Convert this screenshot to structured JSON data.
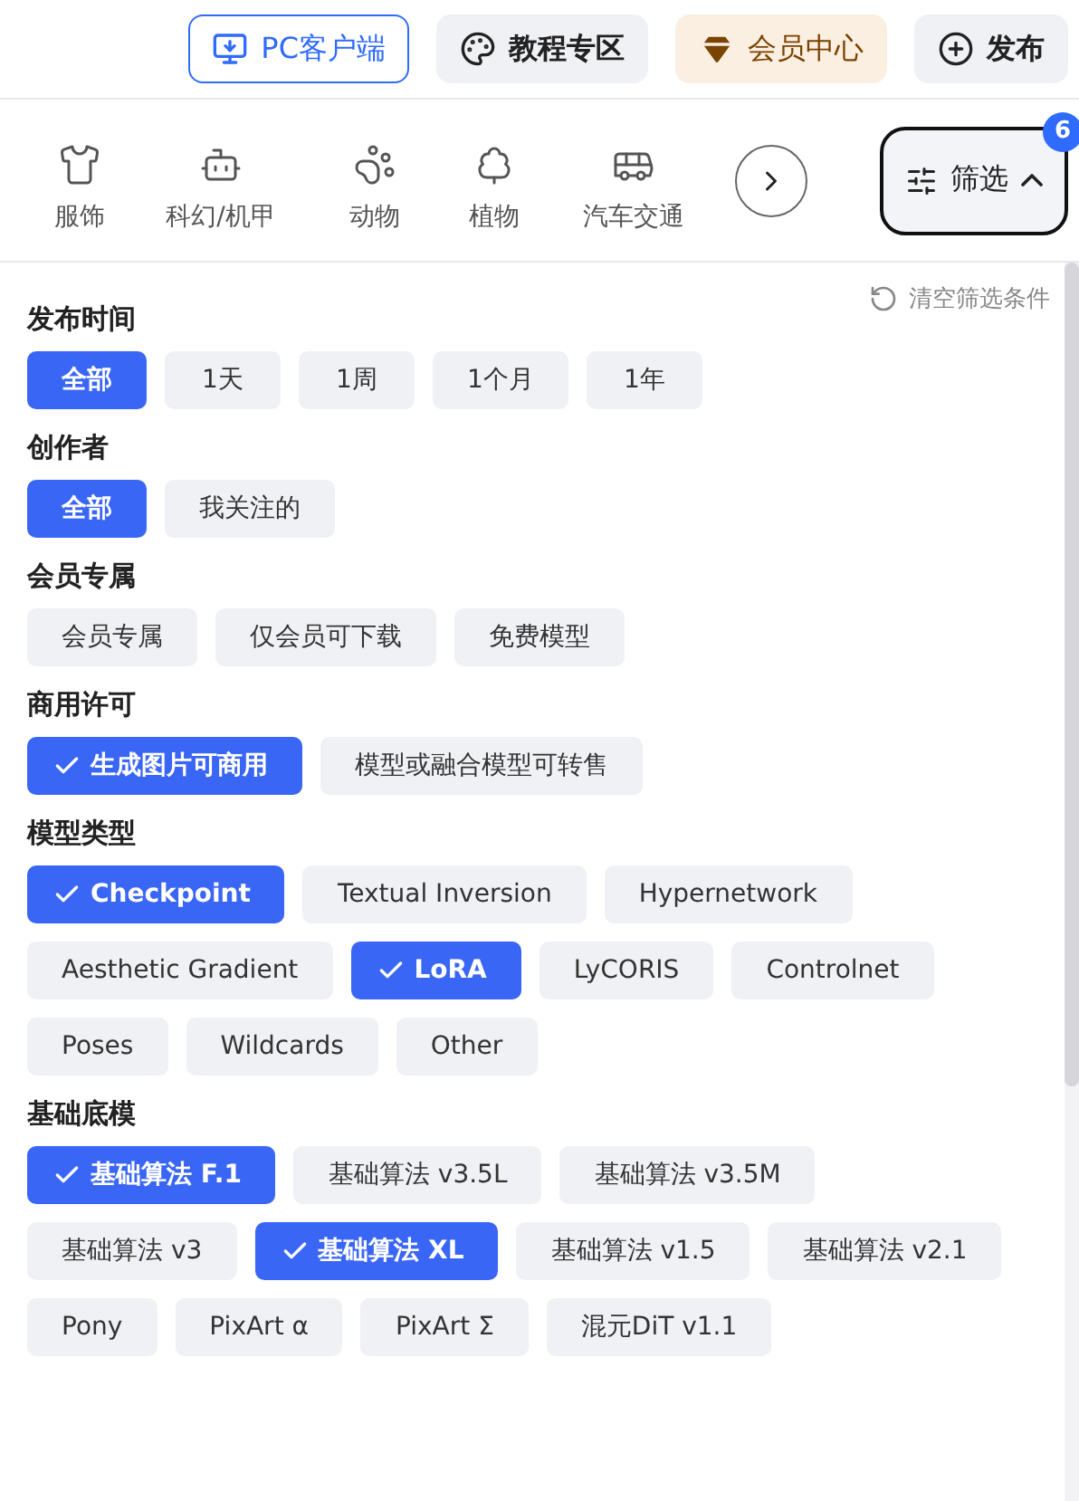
{
  "top_nav": [
    {
      "kind": "outline",
      "label": "PC客户端"
    },
    {
      "kind": "plain",
      "label": "教程专区"
    },
    {
      "kind": "vip",
      "label": "会员中心"
    },
    {
      "kind": "plain",
      "label": "发布"
    }
  ],
  "categories": [
    {
      "label": "服饰"
    },
    {
      "label": "科幻/机甲"
    },
    {
      "label": "动物"
    },
    {
      "label": "植物"
    },
    {
      "label": "汽车交通"
    }
  ],
  "filter_button": {
    "label": "筛选",
    "badge": "6",
    "expanded": true
  },
  "clear_filters": "清空筛选条件",
  "sections": [
    {
      "title": "发布时间",
      "options": [
        {
          "label": "全部",
          "selected": true
        },
        {
          "label": "1天",
          "selected": false
        },
        {
          "label": "1周",
          "selected": false
        },
        {
          "label": "1个月",
          "selected": false
        },
        {
          "label": "1年",
          "selected": false
        }
      ]
    },
    {
      "title": "创作者",
      "options": [
        {
          "label": "全部",
          "selected": true
        },
        {
          "label": "我关注的",
          "selected": false
        }
      ]
    },
    {
      "title": "会员专属",
      "options": [
        {
          "label": "会员专属",
          "selected": false
        },
        {
          "label": "仅会员可下载",
          "selected": false
        },
        {
          "label": "免费模型",
          "selected": false
        }
      ]
    },
    {
      "title": "商用许可",
      "options": [
        {
          "label": "生成图片可商用",
          "selected": true
        },
        {
          "label": "模型或融合模型可转售",
          "selected": false
        }
      ]
    },
    {
      "title": "模型类型",
      "options": [
        {
          "label": "Checkpoint",
          "selected": true
        },
        {
          "label": "Textual Inversion",
          "selected": false
        },
        {
          "label": "Hypernetwork",
          "selected": false
        },
        {
          "label": "Aesthetic Gradient",
          "selected": false
        },
        {
          "label": "LoRA",
          "selected": true
        },
        {
          "label": "LyCORIS",
          "selected": false
        },
        {
          "label": "Controlnet",
          "selected": false
        },
        {
          "label": "Poses",
          "selected": false
        },
        {
          "label": "Wildcards",
          "selected": false
        },
        {
          "label": "Other",
          "selected": false
        }
      ]
    },
    {
      "title": "基础底模",
      "options": [
        {
          "label": "基础算法 F.1",
          "selected": true
        },
        {
          "label": "基础算法 v3.5L",
          "selected": false
        },
        {
          "label": "基础算法 v3.5M",
          "selected": false
        },
        {
          "label": "基础算法 v3",
          "selected": false
        },
        {
          "label": "基础算法 XL",
          "selected": true
        },
        {
          "label": "基础算法 v1.5",
          "selected": false
        },
        {
          "label": "基础算法 v2.1",
          "selected": false
        },
        {
          "label": "Pony",
          "selected": false
        },
        {
          "label": "PixArt α",
          "selected": false
        },
        {
          "label": "PixArt Σ",
          "selected": false
        },
        {
          "label": "混元DiT v1.1",
          "selected": false
        }
      ]
    }
  ]
}
